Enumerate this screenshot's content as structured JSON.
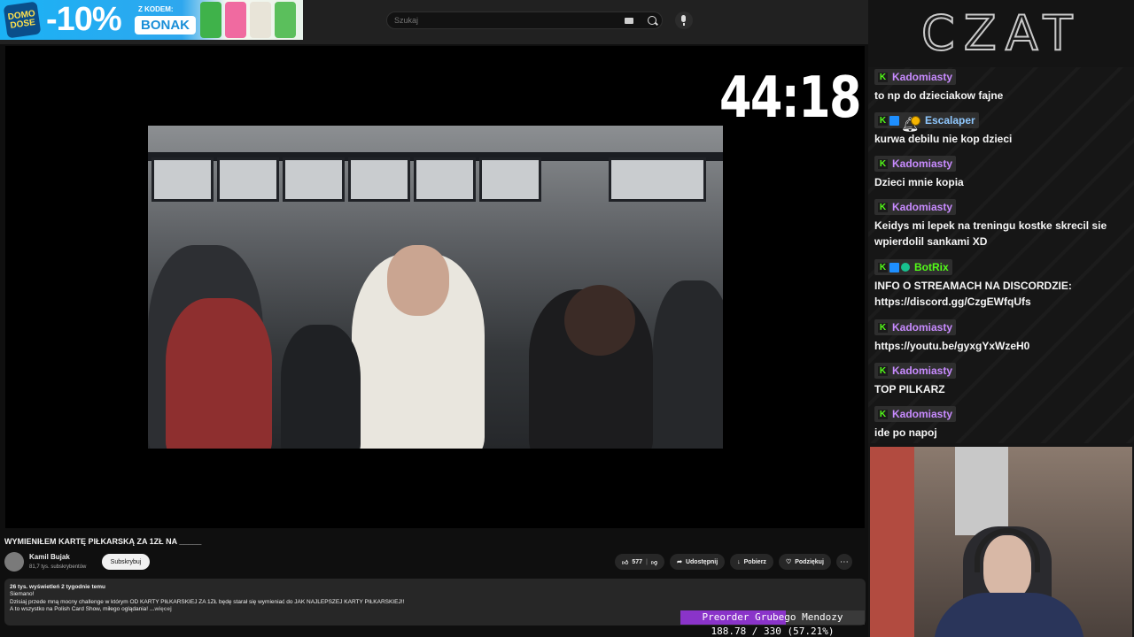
{
  "promo": {
    "logo_text": "DOMO DOSE",
    "discount": "-10%",
    "code_label": "Z KODEM:",
    "code": "BONAK",
    "can_colors": [
      "#3fb24a",
      "#f06aa0",
      "#e8e4d8",
      "#5bbf5c"
    ]
  },
  "search": {
    "placeholder": "Szukaj"
  },
  "player": {
    "timer": "44:18"
  },
  "video": {
    "title": "WYMIENIŁEM KARTĘ PIŁKARSKĄ ZA 1ZŁ NA _____",
    "channel": "Kamil Bujak",
    "subscribers": "81,7 tys. subskrybentów",
    "subscribe_label": "Subskrybuj",
    "likes": "577",
    "share_label": "Udostępnij",
    "download_label": "Pobierz",
    "thanks_label": "Podziękuj",
    "more_label": "⋯"
  },
  "description": {
    "stats": "26 tys. wyświetleń  2 tygodnie temu",
    "line1": "Siemano!",
    "line2": "Dzisiaj przede mną mocny challenge w którym OD KARTY PIŁKARSKIEJ ZA 1ZŁ będę starał się wymieniać do JAK NAJLEPSZEJ KARTY PIŁKARSKIEJ!!",
    "line3": "A to wszystko na Polish Card Show, miłego oglądania!",
    "more_link": "...więcej"
  },
  "chat": {
    "title": "CZAT",
    "messages": [
      {
        "user": "Kadomiasty",
        "text": "to np do dzieciakow fajne"
      },
      {
        "user": "Escalaper",
        "text": "kurwa debilu nie kop dzieci"
      },
      {
        "user": "Kadomiasty",
        "text": "Dzieci mnie kopia"
      },
      {
        "user": "Kadomiasty",
        "text": "Keidys mi lepek na treningu kostke skrecil sie wpierdolil sankami XD"
      },
      {
        "user": "BotRix",
        "text": "INFO O STREAMACH NA DISCORDZIE: https://discord.gg/CzgEWfqUfs"
      },
      {
        "user": "Kadomiasty",
        "text": "https://youtu.be/gyxgYxWzeH0"
      },
      {
        "user": "Kadomiasty",
        "text": "TOP PILKARZ"
      },
      {
        "user": "Kadomiasty",
        "text": "ide po napoj"
      }
    ],
    "badge_letter": "K"
  },
  "goal": {
    "label": "Preorder Grubego Mendozy",
    "value": "188.78 / 330 (57.21%)",
    "progress": 0.5721,
    "fill_color": "#8a34c9"
  }
}
